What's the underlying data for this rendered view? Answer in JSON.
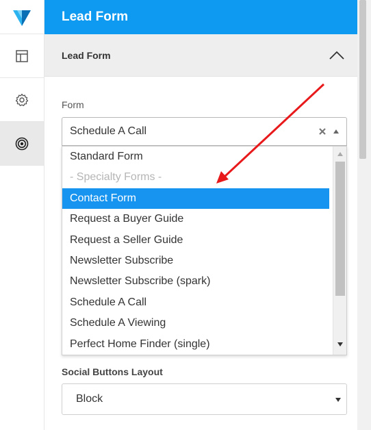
{
  "header": {
    "title": "Lead Form"
  },
  "section": {
    "title": "Lead Form"
  },
  "form_field": {
    "label": "Form",
    "selected": "Schedule A Call",
    "options": [
      {
        "label": "Standard Form",
        "type": "option"
      },
      {
        "label": "- Specialty Forms -",
        "type": "group"
      },
      {
        "label": "Contact Form",
        "type": "option",
        "highlighted": true
      },
      {
        "label": "Request a Buyer Guide",
        "type": "option"
      },
      {
        "label": "Request a Seller Guide",
        "type": "option"
      },
      {
        "label": "Newsletter Subscribe",
        "type": "option"
      },
      {
        "label": "Newsletter Subscribe (spark)",
        "type": "option"
      },
      {
        "label": "Schedule A Call",
        "type": "option"
      },
      {
        "label": "Schedule A Viewing",
        "type": "option"
      },
      {
        "label": "Perfect Home Finder (single)",
        "type": "option"
      }
    ]
  },
  "social_field": {
    "label": "Social Buttons Layout",
    "selected": "Block"
  },
  "sidebar": {
    "items": [
      {
        "icon": "layout-icon"
      },
      {
        "icon": "gear-icon"
      },
      {
        "icon": "target-icon",
        "active": true
      }
    ]
  },
  "colors": {
    "brand": "#0e9af0",
    "highlight": "#1794f0",
    "annotation_arrow": "#e8191b"
  }
}
